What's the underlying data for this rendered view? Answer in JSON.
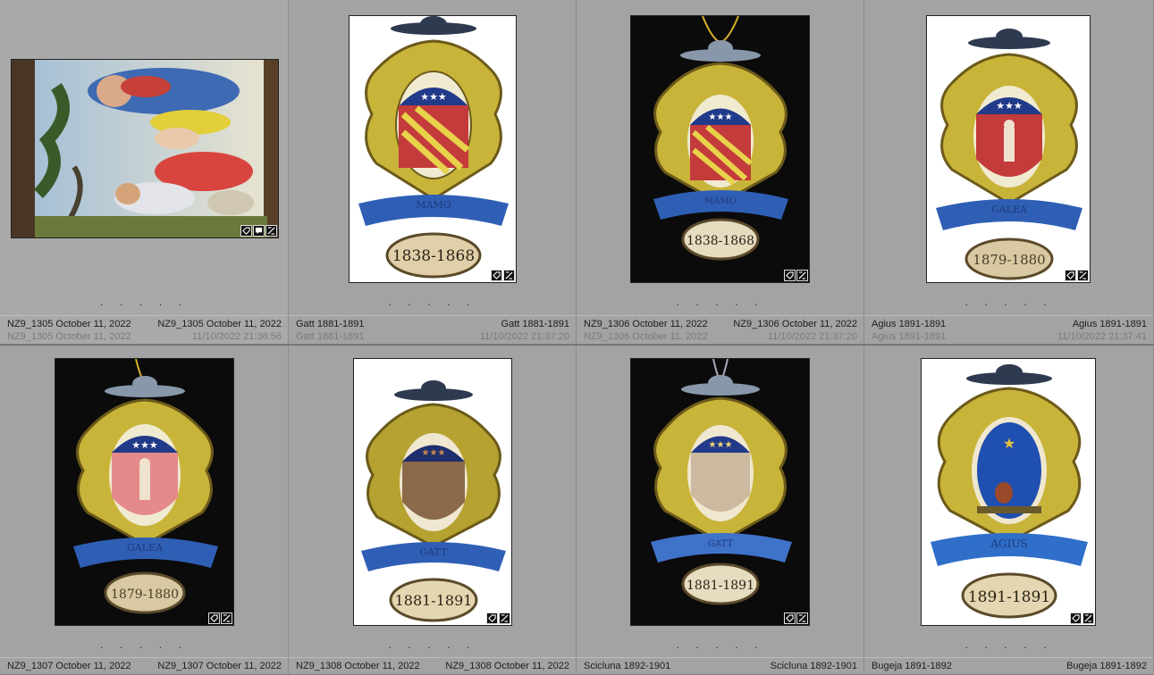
{
  "cells": [
    {
      "line1_left": "NZ9_1305  October 11, 2022",
      "line1_right": "NZ9_1305  October 11, 2022",
      "line2_left": "NZ9_1305  October 11, 2022",
      "line2_right": "11/10/2022 21:36:56",
      "dots": "· · · · ·",
      "badges": [
        "tag-icon",
        "comment-icon",
        "edited-icon"
      ]
    },
    {
      "line1_left": "Gatt 1881-1891",
      "line1_right": "Gatt 1881-1891",
      "line2_left": "Gatt 1881-1891",
      "line2_right": "11/10/2022 21:37:20",
      "dots": "· · · · ·",
      "badges": [
        "tag-icon",
        "edited-icon"
      ],
      "motto": "MAMO",
      "years": "1838-1868"
    },
    {
      "line1_left": "NZ9_1306  October 11, 2022",
      "line1_right": "NZ9_1306  October 11, 2022",
      "line2_left": "NZ9_1306  October 11, 2022",
      "line2_right": "11/10/2022 21:37:20",
      "dots": "· · · · ·",
      "badges": [
        "tag-icon",
        "edited-icon"
      ],
      "motto": "MAMO",
      "years": "1838-1868"
    },
    {
      "line1_left": "Agius 1891-1891",
      "line1_right": "Agius 1891-1891",
      "line2_left": "Agius 1891-1891",
      "line2_right": "11/10/2022 21:37:41",
      "dots": "· · · · ·",
      "badges": [
        "tag-icon",
        "edited-icon"
      ],
      "motto": "GALEA",
      "years": "1879-1880"
    },
    {
      "line1_left": "NZ9_1307  October 11, 2022",
      "line1_right": "NZ9_1307  October 11, 2022",
      "dots": "· · · · ·",
      "badges": [
        "tag-icon",
        "edited-icon"
      ],
      "motto": "GALEA",
      "years": "1879-1880"
    },
    {
      "line1_left": "NZ9_1308  October 11, 2022",
      "line1_right": "NZ9_1308  October 11, 2022",
      "dots": "· · · · ·",
      "badges": [
        "tag-icon",
        "edited-icon"
      ],
      "motto": "GATT",
      "years": "1881-1891"
    },
    {
      "line1_left": "Scicluna 1892-1901",
      "line1_right": "Scicluna 1892-1901",
      "dots": "· · · · ·",
      "badges": [
        "tag-icon",
        "edited-icon"
      ],
      "motto": "GATT",
      "years": "1881-1891"
    },
    {
      "line1_left": "Bugeja 1891-1892",
      "line1_right": "Bugeja 1891-1892",
      "dots": "· · · · ·",
      "badges": [
        "tag-icon",
        "edited-icon"
      ],
      "motto": "AGIUS",
      "years": "1891-1891"
    }
  ],
  "colors": {
    "cell_bg": "#a3a3a3",
    "gold": "#c9b43a",
    "blue_banner": "#2f5fb5",
    "red_field": "#c43b3b",
    "navy": "#1f2f6e"
  }
}
